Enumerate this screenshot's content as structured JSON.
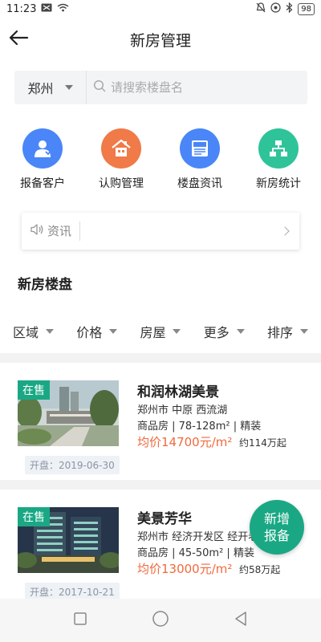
{
  "status_bar": {
    "time": "11:23",
    "battery": "98"
  },
  "header": {
    "title": "新房管理"
  },
  "search": {
    "city": "郑州",
    "placeholder": "请搜索楼盘名"
  },
  "quick_actions": [
    {
      "label": "报备客户",
      "icon": "customer-icon",
      "color": "#4a86f7"
    },
    {
      "label": "认购管理",
      "icon": "house-icon",
      "color": "#f07a48"
    },
    {
      "label": "楼盘资讯",
      "icon": "news-icon",
      "color": "#4a86f7"
    },
    {
      "label": "新房统计",
      "icon": "org-chart-icon",
      "color": "#2fc39a"
    }
  ],
  "news": {
    "label": "资讯"
  },
  "section": {
    "title": "新房楼盘"
  },
  "filters": [
    "区域",
    "价格",
    "房屋",
    "更多",
    "排序"
  ],
  "listings": [
    {
      "status": "在售",
      "name": "和润林湖美景",
      "location": "郑州市 中原 西流湖",
      "type_info": "商品房 | 78-128m² | 精装",
      "avg_price": "均价14700元/m²",
      "total_price": "约114万起",
      "open_date": "开盘：2019-06-30"
    },
    {
      "status": "在售",
      "name": "美景芳华",
      "location": "郑州市 经济开发区 经开老",
      "type_info": "商品房 | 45-50m² | 精装",
      "avg_price": "均价13000元/m²",
      "total_price": "约58万起",
      "open_date": "开盘：2017-10-21"
    }
  ],
  "fab": {
    "line1": "新增",
    "line2": "报备"
  },
  "colors": {
    "accent": "#1aa884",
    "price": "#f06a3c"
  }
}
